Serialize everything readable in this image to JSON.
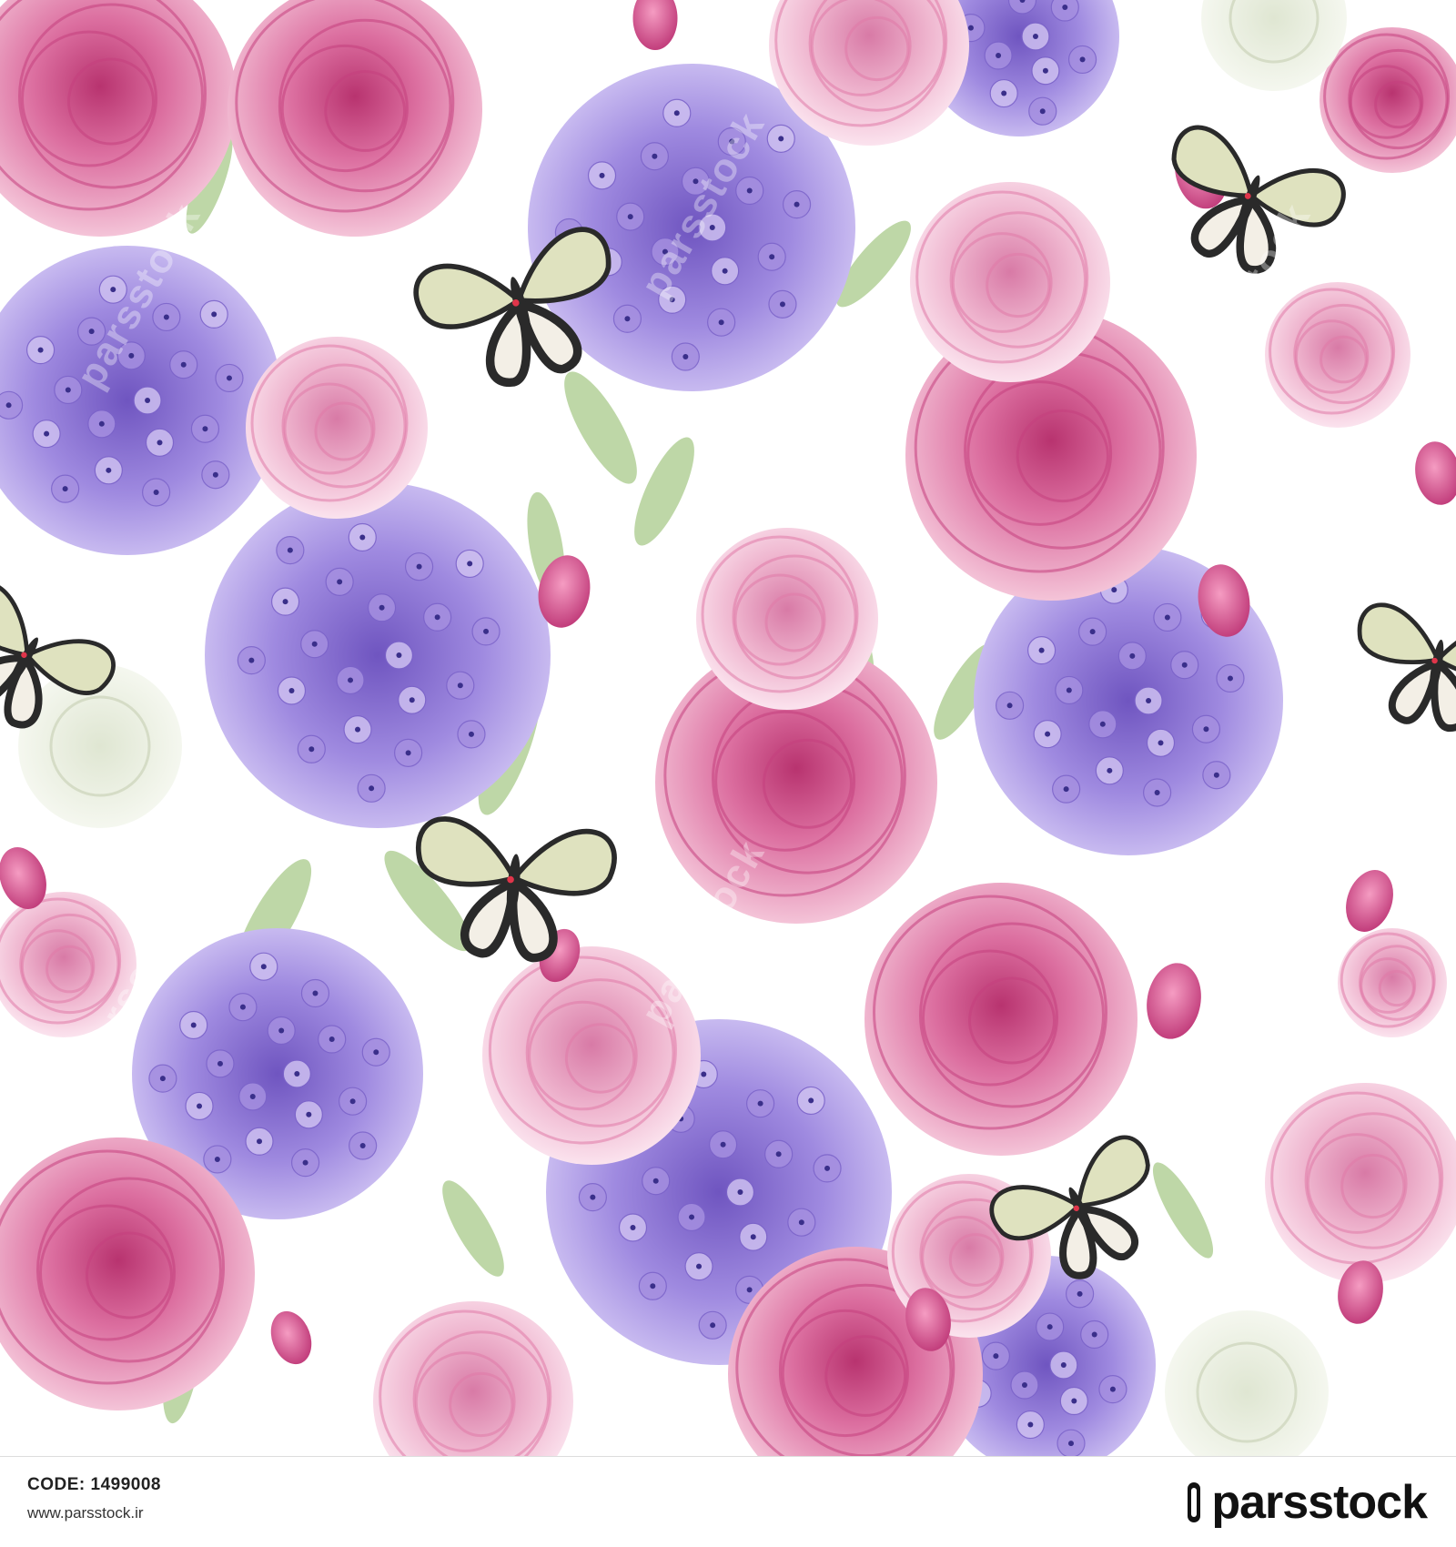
{
  "artwork": {
    "description_icon": "watercolor-floral-pattern",
    "palette": {
      "rose_deep": "#c4407e",
      "rose_mid": "#e07aa8",
      "rose_light": "#f3c6da",
      "hydrangea_deep": "#7b63c9",
      "hydrangea_mid": "#a58fe0",
      "hydrangea_light": "#cdbff0",
      "leaf": "#a8c98a",
      "white_rose": "#eef2e6",
      "butterfly_wing": "#dfe2bf",
      "butterfly_dark": "#2a2a2a"
    }
  },
  "watermark": {
    "text": "parsstock"
  },
  "footer": {
    "code_label": "CODE:",
    "code_value": "1499008",
    "website": "www.parsstock.ir",
    "brand": "parsstock"
  }
}
